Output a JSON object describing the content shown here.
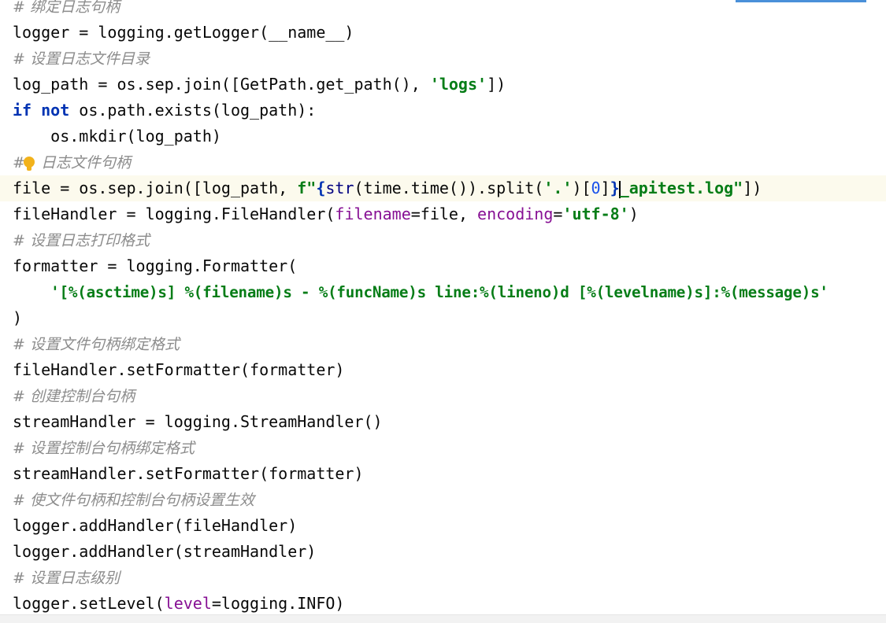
{
  "editor": {
    "lines": [
      {
        "c": "# 绑定日志句柄"
      },
      {
        "a": "logger = logging.getLogger(__name__)"
      },
      {
        "c": "# 设置日志文件目录"
      },
      {
        "a": "log_path = os.sep.join([GetPath.get_path(), ",
        "s": "'logs'",
        "b": "])"
      },
      {
        "k1": "if",
        "sp": " ",
        "k2": "not",
        "a": " os.path.exists(log_path):"
      },
      {
        "a": "    os.mkdir(log_path)"
      },
      {
        "p": "#",
        "c": "日志文件句柄"
      },
      {
        "a": "file = os.sep.join([log_path, ",
        "s1": "f\"",
        "s2": "{",
        "bi": "str",
        "a2": "(time.time()).split(",
        "s3": "'.'",
        "a3": ")[",
        "n": "0",
        "a4": "]",
        "s4": "}",
        "s5": "_apitest.log\"",
        "b": "])"
      },
      {
        "a": "fileHandler = logging.FileHandler(",
        "p1": "filename",
        "a2": "=file, ",
        "p2": "encoding",
        "a3": "=",
        "s": "'utf-8'",
        "b": ")"
      },
      {
        "c": "# 设置日志打印格式"
      },
      {
        "a": "formatter = logging.Formatter("
      },
      {
        "a": "    ",
        "s": "'[%(asctime)s] %(filename)s - %(funcName)s line:%(lineno)d [%(levelname)s]:%(message)s'"
      },
      {
        "a": ")"
      },
      {
        "c": "# 设置文件句柄绑定格式"
      },
      {
        "a": "fileHandler.setFormatter(formatter)"
      },
      {
        "c": "# 创建控制台句柄"
      },
      {
        "a": "streamHandler = logging.StreamHandler()"
      },
      {
        "c": "# 设置控制台句柄绑定格式"
      },
      {
        "a": "streamHandler.setFormatter(formatter)"
      },
      {
        "c": "# 使文件句柄和控制台句柄设置生效"
      },
      {
        "a": "logger.addHandler(fileHandler)"
      },
      {
        "a": "logger.addHandler(streamHandler)"
      },
      {
        "c": "# 设置日志级别"
      },
      {
        "a": "logger.setLevel(",
        "p1": "level",
        "a2": "=logging.INFO)"
      }
    ]
  },
  "theme": {
    "comment_color": "#8c8c8c",
    "keyword_color": "#0033b3",
    "string_color": "#067d17",
    "param_color": "#871094",
    "current_line_bg": "#fcfaed",
    "intention_bulb_color": "#f2b21b"
  },
  "icons": {
    "intention_bulb": "lightbulb-icon"
  }
}
